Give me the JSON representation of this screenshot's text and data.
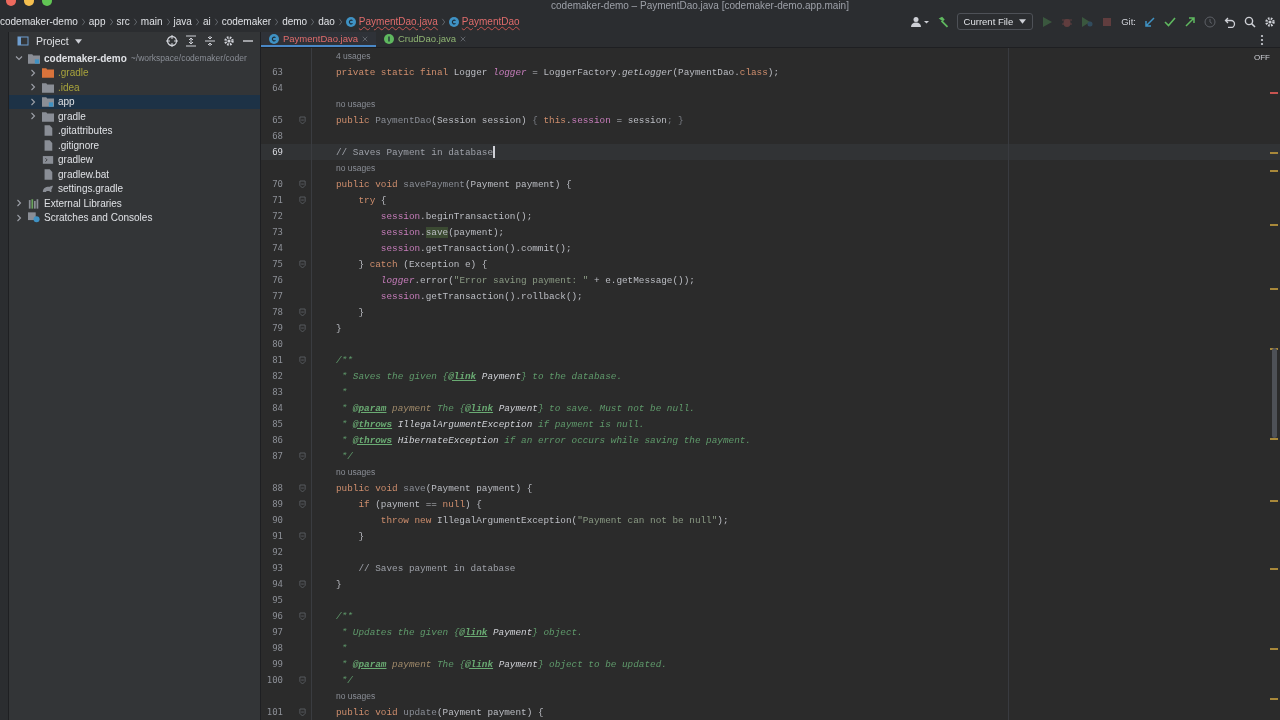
{
  "window": {
    "title": "codemaker-demo – PaymentDao.java [codemaker-demo.app.main]"
  },
  "breadcrumbs": [
    {
      "label": "codemaker-demo",
      "kind": "folder",
      "has_errors": false
    },
    {
      "label": "app",
      "kind": "folder",
      "has_errors": false
    },
    {
      "label": "src",
      "kind": "folder",
      "has_errors": false
    },
    {
      "label": "main",
      "kind": "folder",
      "has_errors": false
    },
    {
      "label": "java",
      "kind": "folder",
      "has_errors": false
    },
    {
      "label": "ai",
      "kind": "folder",
      "has_errors": false
    },
    {
      "label": "codemaker",
      "kind": "folder",
      "has_errors": false
    },
    {
      "label": "demo",
      "kind": "folder",
      "has_errors": false
    },
    {
      "label": "dao",
      "kind": "folder",
      "has_errors": false
    },
    {
      "label": "PaymentDao.java",
      "kind": "class",
      "has_errors": true
    },
    {
      "label": "PaymentDao",
      "kind": "class",
      "has_errors": true
    }
  ],
  "toolbar": {
    "run_config": "Current File",
    "git_label": "Git:",
    "run_buttons": [
      {
        "kind": "run",
        "disabled": true
      },
      {
        "kind": "debug",
        "disabled": true
      },
      {
        "kind": "coverage",
        "disabled": true
      },
      {
        "kind": "stop",
        "disabled": true
      }
    ]
  },
  "project_panel": {
    "title": "Project",
    "tree": [
      {
        "label": "codemaker-demo",
        "detail": "~/workspace/codemaker/coder",
        "kind": "module",
        "expanded": true,
        "selected": false,
        "ignored": false,
        "children": [
          {
            "label": ".gradle",
            "kind": "folder-excluded",
            "expanded": false,
            "selected": false,
            "ignored": true
          },
          {
            "label": ".idea",
            "kind": "folder",
            "expanded": false,
            "selected": false,
            "ignored": true
          },
          {
            "label": "app",
            "kind": "module",
            "expanded": false,
            "selected": true,
            "ignored": false
          },
          {
            "label": "gradle",
            "kind": "folder",
            "expanded": false,
            "selected": false,
            "ignored": false
          },
          {
            "label": ".gitattributes",
            "kind": "file",
            "selected": false,
            "ignored": false
          },
          {
            "label": ".gitignore",
            "kind": "file",
            "selected": false,
            "ignored": false
          },
          {
            "label": "gradlew",
            "kind": "script",
            "selected": false,
            "ignored": false
          },
          {
            "label": "gradlew.bat",
            "kind": "file",
            "selected": false,
            "ignored": false
          },
          {
            "label": "settings.gradle",
            "kind": "gradle",
            "selected": false,
            "ignored": false
          }
        ]
      },
      {
        "label": "External Libraries",
        "kind": "library",
        "expanded": false,
        "selected": false,
        "ignored": false
      },
      {
        "label": "Scratches and Consoles",
        "kind": "scratch",
        "expanded": false,
        "selected": false,
        "ignored": false
      }
    ]
  },
  "tabs": [
    {
      "label": "PaymentDao.java",
      "kind": "class",
      "selected": true,
      "has_errors": true,
      "is_new": false
    },
    {
      "label": "CrudDao.java",
      "kind": "interface",
      "selected": false,
      "has_errors": false,
      "is_new": true
    }
  ],
  "inspection_status": "OFF",
  "editor": {
    "lines": [
      {
        "kind": "hint",
        "text": "4 usages"
      },
      {
        "kind": "code",
        "n": "63",
        "fold": false,
        "current": false,
        "segs": [
          {
            "kind": "kw",
            "text": "private static final "
          },
          {
            "kind": "plain",
            "text": "Logger "
          },
          {
            "kind": "sfield",
            "text": "logger"
          },
          {
            "kind": "plain",
            "text": " = LoggerFactory."
          },
          {
            "kind": "icall",
            "text": "getLogger"
          },
          {
            "kind": "plain",
            "text": "(PaymentDao."
          },
          {
            "kind": "kw",
            "text": "class"
          },
          {
            "kind": "plain",
            "text": ");"
          }
        ]
      },
      {
        "kind": "code",
        "n": "64",
        "fold": false,
        "current": false
      },
      {
        "kind": "hint",
        "text": "no usages"
      },
      {
        "kind": "code",
        "n": "65",
        "fold": true,
        "current": false,
        "segs": [
          {
            "kind": "kw",
            "text": "public "
          },
          {
            "kind": "unused",
            "text": "PaymentDao"
          },
          {
            "kind": "plain",
            "text": "(Session session) "
          },
          {
            "kind": "dim",
            "text": "{ "
          },
          {
            "kind": "kw",
            "text": "this"
          },
          {
            "kind": "plain",
            "text": "."
          },
          {
            "kind": "field",
            "text": "session"
          },
          {
            "kind": "plain",
            "text": " = session"
          },
          {
            "kind": "dim",
            "text": "; }"
          }
        ]
      },
      {
        "kind": "code",
        "n": "68",
        "fold": false,
        "current": false
      },
      {
        "kind": "code",
        "n": "69",
        "fold": false,
        "current": true,
        "segs": [
          {
            "kind": "comment",
            "text": "// Saves Payment in database"
          }
        ]
      },
      {
        "kind": "hint",
        "text": "no usages"
      },
      {
        "kind": "code",
        "n": "70",
        "fold": true,
        "current": false,
        "segs": [
          {
            "kind": "kw",
            "text": "public void "
          },
          {
            "kind": "unused",
            "text": "savePayment"
          },
          {
            "kind": "plain",
            "text": "(Payment payment) {"
          }
        ]
      },
      {
        "kind": "code",
        "n": "71",
        "fold": true,
        "current": false,
        "segs": [
          {
            "kind": "kw",
            "text": "    try"
          },
          {
            "kind": "plain",
            "text": " {"
          }
        ]
      },
      {
        "kind": "code",
        "n": "72",
        "fold": false,
        "current": false,
        "segs": [
          {
            "kind": "field",
            "text": "        session"
          },
          {
            "kind": "plain",
            "text": ".beginTransaction();"
          }
        ]
      },
      {
        "kind": "code",
        "n": "73",
        "fold": false,
        "current": false,
        "segs": [
          {
            "kind": "field",
            "text": "        session"
          },
          {
            "kind": "plain",
            "text": "."
          },
          {
            "kind": "mark",
            "text": "save"
          },
          {
            "kind": "plain",
            "text": "(payment);"
          }
        ]
      },
      {
        "kind": "code",
        "n": "74",
        "fold": false,
        "current": false,
        "segs": [
          {
            "kind": "field",
            "text": "        session"
          },
          {
            "kind": "plain",
            "text": ".getTransaction().commit();"
          }
        ]
      },
      {
        "kind": "code",
        "n": "75",
        "fold": true,
        "current": false,
        "segs": [
          {
            "kind": "plain",
            "text": "    } "
          },
          {
            "kind": "kw",
            "text": "catch"
          },
          {
            "kind": "plain",
            "text": " (Exception e) {"
          }
        ]
      },
      {
        "kind": "code",
        "n": "76",
        "fold": false,
        "current": false,
        "segs": [
          {
            "kind": "sfield",
            "text": "        logger"
          },
          {
            "kind": "plain",
            "text": ".error("
          },
          {
            "kind": "string",
            "text": "\"Error saving payment: \""
          },
          {
            "kind": "plain",
            "text": " + e.getMessage());"
          }
        ]
      },
      {
        "kind": "code",
        "n": "77",
        "fold": false,
        "current": false,
        "segs": [
          {
            "kind": "field",
            "text": "        session"
          },
          {
            "kind": "plain",
            "text": ".getTransaction().rollback();"
          }
        ]
      },
      {
        "kind": "code",
        "n": "78",
        "fold": true,
        "current": false,
        "segs": [
          {
            "kind": "plain",
            "text": "    }"
          }
        ]
      },
      {
        "kind": "code",
        "n": "79",
        "fold": true,
        "current": false,
        "segs": [
          {
            "kind": "plain",
            "text": "}"
          }
        ]
      },
      {
        "kind": "code",
        "n": "80",
        "fold": false,
        "current": false
      },
      {
        "kind": "code",
        "n": "81",
        "fold": true,
        "current": false,
        "segs": [
          {
            "kind": "doc",
            "text": "/**"
          }
        ]
      },
      {
        "kind": "code",
        "n": "82",
        "fold": false,
        "current": false,
        "segs": [
          {
            "kind": "doc",
            "text": " * Saves the given {"
          },
          {
            "kind": "doctag",
            "text": "@link"
          },
          {
            "kind": "docref",
            "text": " Payment"
          },
          {
            "kind": "doc",
            "text": "} to the database."
          }
        ]
      },
      {
        "kind": "code",
        "n": "83",
        "fold": false,
        "current": false,
        "segs": [
          {
            "kind": "doc",
            "text": " *"
          }
        ]
      },
      {
        "kind": "code",
        "n": "84",
        "fold": false,
        "current": false,
        "segs": [
          {
            "kind": "doc",
            "text": " * "
          },
          {
            "kind": "doctag",
            "text": "@param"
          },
          {
            "kind": "docparam",
            "text": " payment"
          },
          {
            "kind": "doc",
            "text": " The {"
          },
          {
            "kind": "doctag",
            "text": "@link"
          },
          {
            "kind": "docref",
            "text": " Payment"
          },
          {
            "kind": "doc",
            "text": "} to save. Must not be null."
          }
        ]
      },
      {
        "kind": "code",
        "n": "85",
        "fold": false,
        "current": false,
        "segs": [
          {
            "kind": "doc",
            "text": " * "
          },
          {
            "kind": "doctag",
            "text": "@throws"
          },
          {
            "kind": "docref",
            "text": " IllegalArgumentException"
          },
          {
            "kind": "doc",
            "text": " if payment is null."
          }
        ]
      },
      {
        "kind": "code",
        "n": "86",
        "fold": false,
        "current": false,
        "segs": [
          {
            "kind": "doc",
            "text": " * "
          },
          {
            "kind": "doctag",
            "text": "@throws"
          },
          {
            "kind": "docref",
            "text": " HibernateException"
          },
          {
            "kind": "doc",
            "text": " if an error occurs while saving the payment."
          }
        ]
      },
      {
        "kind": "code",
        "n": "87",
        "fold": true,
        "current": false,
        "segs": [
          {
            "kind": "doc",
            "text": " */"
          }
        ]
      },
      {
        "kind": "hint",
        "text": "no usages"
      },
      {
        "kind": "code",
        "n": "88",
        "fold": true,
        "current": false,
        "segs": [
          {
            "kind": "kw",
            "text": "public void "
          },
          {
            "kind": "unused",
            "text": "save"
          },
          {
            "kind": "plain",
            "text": "(Payment payment) {"
          }
        ]
      },
      {
        "kind": "code",
        "n": "89",
        "fold": true,
        "current": false,
        "segs": [
          {
            "kind": "kw",
            "text": "    if"
          },
          {
            "kind": "plain",
            "text": " (payment == "
          },
          {
            "kind": "kw",
            "text": "null"
          },
          {
            "kind": "plain",
            "text": ") {"
          }
        ]
      },
      {
        "kind": "code",
        "n": "90",
        "fold": false,
        "current": false,
        "segs": [
          {
            "kind": "kw",
            "text": "        throw new "
          },
          {
            "kind": "plain",
            "text": "IllegalArgumentException("
          },
          {
            "kind": "string",
            "text": "\"Payment can not be null\""
          },
          {
            "kind": "plain",
            "text": ");"
          }
        ]
      },
      {
        "kind": "code",
        "n": "91",
        "fold": true,
        "current": false,
        "segs": [
          {
            "kind": "plain",
            "text": "    }"
          }
        ]
      },
      {
        "kind": "code",
        "n": "92",
        "fold": false,
        "current": false
      },
      {
        "kind": "code",
        "n": "93",
        "fold": false,
        "current": false,
        "segs": [
          {
            "kind": "comment",
            "text": "    // Saves payment in database"
          }
        ]
      },
      {
        "kind": "code",
        "n": "94",
        "fold": true,
        "current": false,
        "segs": [
          {
            "kind": "plain",
            "text": "}"
          }
        ]
      },
      {
        "kind": "code",
        "n": "95",
        "fold": false,
        "current": false
      },
      {
        "kind": "code",
        "n": "96",
        "fold": true,
        "current": false,
        "segs": [
          {
            "kind": "doc",
            "text": "/**"
          }
        ]
      },
      {
        "kind": "code",
        "n": "97",
        "fold": false,
        "current": false,
        "segs": [
          {
            "kind": "doc",
            "text": " * Updates the given {"
          },
          {
            "kind": "doctag",
            "text": "@link"
          },
          {
            "kind": "docref",
            "text": " Payment"
          },
          {
            "kind": "doc",
            "text": "} object."
          }
        ]
      },
      {
        "kind": "code",
        "n": "98",
        "fold": false,
        "current": false,
        "segs": [
          {
            "kind": "doc",
            "text": " *"
          }
        ]
      },
      {
        "kind": "code",
        "n": "99",
        "fold": false,
        "current": false,
        "segs": [
          {
            "kind": "doc",
            "text": " * "
          },
          {
            "kind": "doctag",
            "text": "@param"
          },
          {
            "kind": "docparam",
            "text": " payment"
          },
          {
            "kind": "doc",
            "text": " The {"
          },
          {
            "kind": "doctag",
            "text": "@link"
          },
          {
            "kind": "docref",
            "text": " Payment"
          },
          {
            "kind": "doc",
            "text": "} object to be updated."
          }
        ]
      },
      {
        "kind": "code",
        "n": "100",
        "fold": true,
        "current": false,
        "segs": [
          {
            "kind": "doc",
            "text": " */"
          }
        ]
      },
      {
        "kind": "hint",
        "text": "no usages"
      },
      {
        "kind": "code",
        "n": "101",
        "fold": true,
        "current": false,
        "segs": [
          {
            "kind": "kw",
            "text": "public void "
          },
          {
            "kind": "unused",
            "text": "update"
          },
          {
            "kind": "plain",
            "text": "(Payment payment) {"
          }
        ]
      }
    ]
  }
}
